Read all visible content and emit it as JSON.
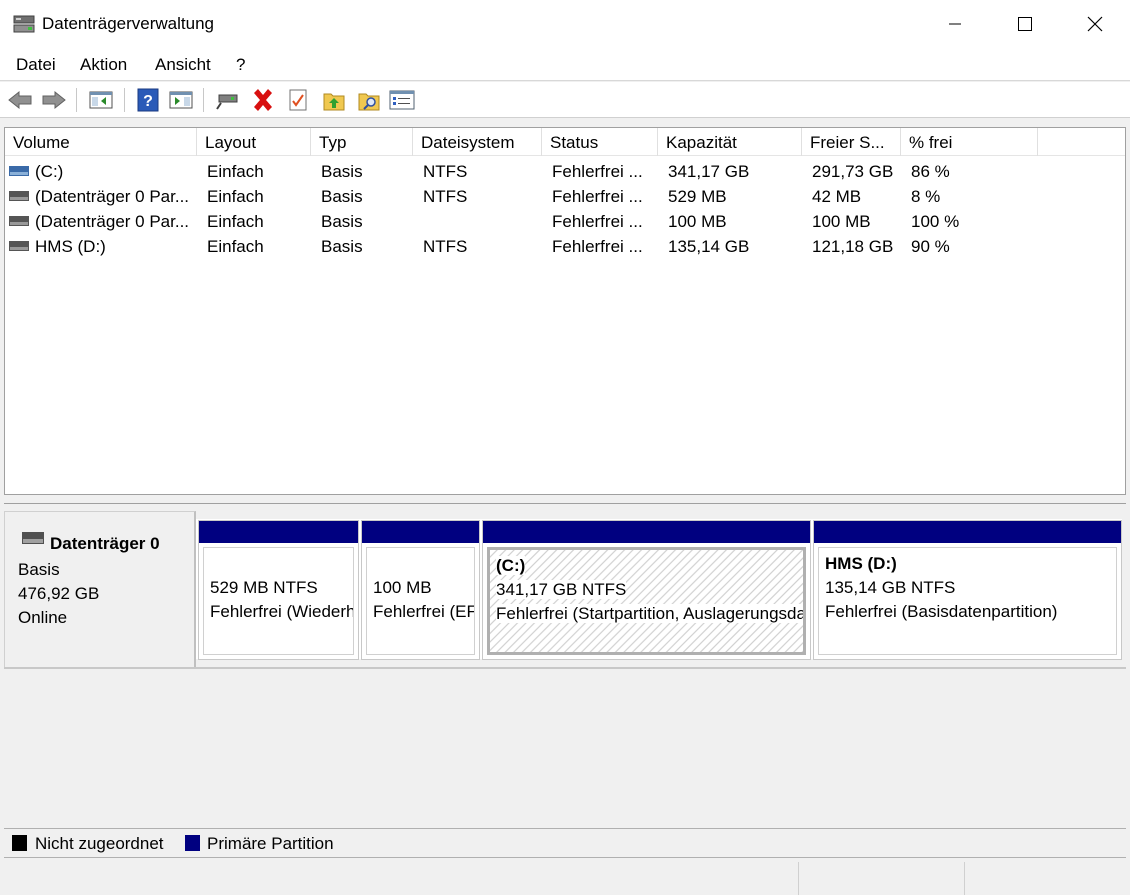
{
  "window": {
    "title": "Datenträgerverwaltung",
    "icon": "disk-management-icon",
    "controls": [
      "minimize-icon",
      "maximize-icon",
      "close-icon"
    ]
  },
  "menu": {
    "items": [
      "Datei",
      "Aktion",
      "Ansicht",
      "?"
    ]
  },
  "toolbar": {
    "buttons": [
      "back-arrow-icon",
      "forward-arrow-icon",
      "show-hide-console-tree-icon",
      "help-icon",
      "show-hide-action-pane-icon",
      "connect-disk-icon",
      "delete-icon",
      "properties-checklist-icon",
      "export-list-icon",
      "search-folder-icon",
      "settings-list-icon"
    ]
  },
  "volumes": {
    "columns": [
      "Volume",
      "Layout",
      "Typ",
      "Dateisystem",
      "Status",
      "Kapazität",
      "Freier S...",
      "% frei"
    ],
    "rows": [
      {
        "volume": " (C:)",
        "layout": "Einfach",
        "typ": "Basis",
        "fs": "NTFS",
        "status": "Fehlerfrei ...",
        "capacity": "341,17 GB",
        "free": "291,73 GB",
        "pct": "86 %"
      },
      {
        "volume": "(Datenträger 0 Par...",
        "layout": "Einfach",
        "typ": "Basis",
        "fs": "NTFS",
        "status": "Fehlerfrei ...",
        "capacity": "529 MB",
        "free": "42 MB",
        "pct": "8 %"
      },
      {
        "volume": "(Datenträger 0 Par...",
        "layout": "Einfach",
        "typ": "Basis",
        "fs": "",
        "status": "Fehlerfrei ...",
        "capacity": "100 MB",
        "free": "100 MB",
        "pct": "100 %"
      },
      {
        "volume": "HMS (D:)",
        "layout": "Einfach",
        "typ": "Basis",
        "fs": "NTFS",
        "status": "Fehlerfrei ...",
        "capacity": "135,14 GB",
        "free": "121,18 GB",
        "pct": "90 %"
      }
    ]
  },
  "disk": {
    "name": "Datenträger 0",
    "type": "Basis",
    "size": "476,92 GB",
    "state": "Online",
    "partitions": [
      {
        "title": "",
        "size_fs": "529 MB NTFS",
        "status": "Fehlerfrei (Wiederh"
      },
      {
        "title": "",
        "size_fs": "100 MB",
        "status": "Fehlerfrei (EF"
      },
      {
        "title": "(C:)",
        "size_fs": "341,17 GB NTFS",
        "status": "Fehlerfrei (Startpartition, Auslagerungsdatei"
      },
      {
        "title": "HMS  (D:)",
        "size_fs": "135,14 GB NTFS",
        "status": "Fehlerfrei (Basisdatenpartition)"
      }
    ]
  },
  "legend": {
    "unallocated": "Nicht zugeordnet",
    "primary": "Primäre Partition",
    "unallocated_color": "#000000",
    "primary_color": "#000080"
  }
}
